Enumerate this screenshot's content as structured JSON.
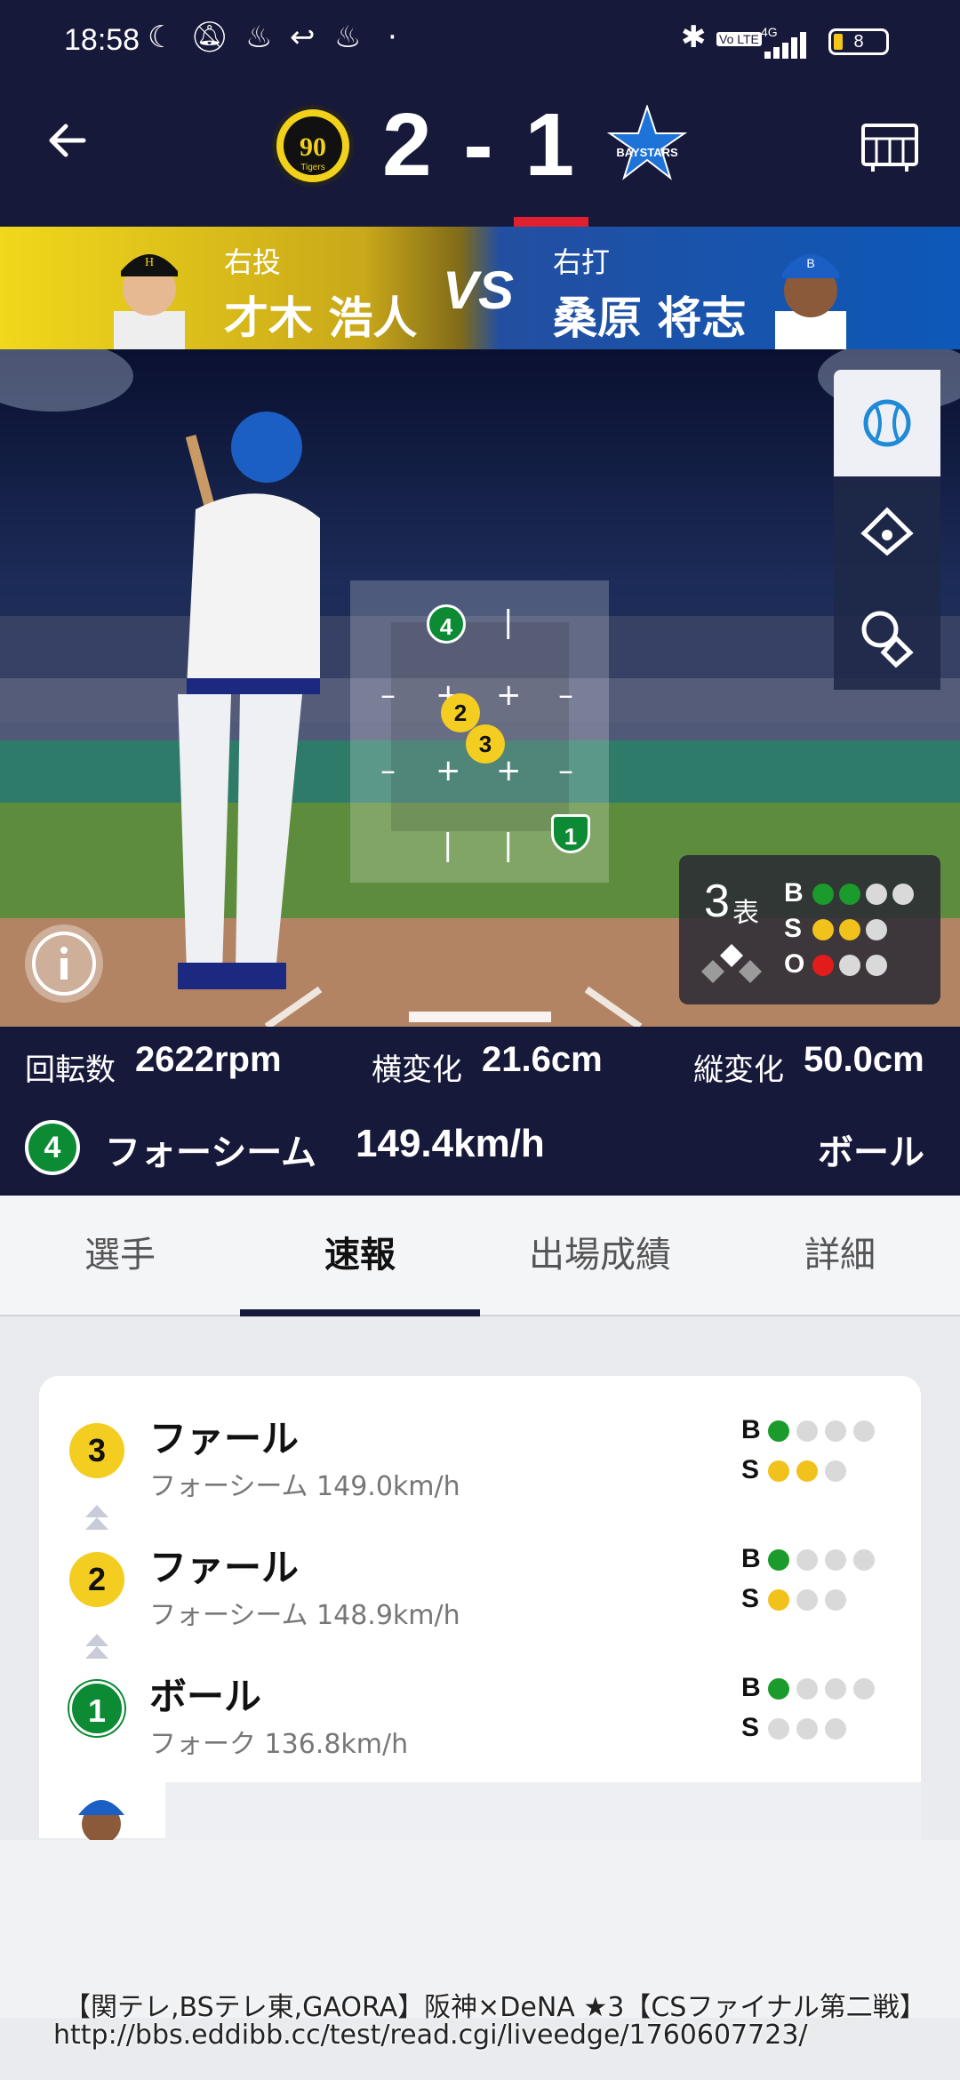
{
  "status_bar": {
    "time": "18:58",
    "battery": "8",
    "network": "4G",
    "volte": "Vo LTE"
  },
  "header": {
    "score": "2 - 1",
    "home_logo": "tigers-90th-logo",
    "away_logo": "baystars-logo",
    "logo_text_home": "Tigers",
    "logo_text_away": "BAYSTARS"
  },
  "matchup": {
    "pitcher_hand": "右投",
    "pitcher_name": "才木 浩人",
    "vs": "VS",
    "batter_hand": "右打",
    "batter_name": "桑原 将志"
  },
  "zone": {
    "pitches": [
      {
        "num": "4",
        "color": "green"
      },
      {
        "num": "2",
        "color": "yellow"
      },
      {
        "num": "3",
        "color": "yellow"
      },
      {
        "num": "1",
        "color": "green"
      }
    ]
  },
  "count": {
    "inning": "3",
    "half": "表",
    "b_label": "B",
    "s_label": "S",
    "o_label": "O",
    "balls": 2,
    "strikes": 2,
    "outs": 1
  },
  "stats": {
    "spin_label": "回転数",
    "spin_value": "2622rpm",
    "hbreak_label": "横変化",
    "hbreak_value": "21.6cm",
    "vbreak_label": "縦変化",
    "vbreak_value": "50.0cm"
  },
  "current_pitch": {
    "num": "4",
    "type": "フォーシーム",
    "speed": "149.4km/h",
    "result": "ボール"
  },
  "tabs": [
    "選手",
    "速報",
    "出場成績",
    "詳細"
  ],
  "feed": [
    {
      "num": "3",
      "title": "ファール",
      "detail": "フォーシーム 149.0km/h",
      "balls": 1,
      "strikes": 2
    },
    {
      "num": "2",
      "title": "ファール",
      "detail": "フォーシーム 148.9km/h",
      "balls": 1,
      "strikes": 1
    },
    {
      "num": "1",
      "title": "ボール",
      "detail": "フォーク 136.8km/h",
      "balls": 1,
      "strikes": 0
    }
  ],
  "feed_labels": {
    "b": "B",
    "s": "S"
  },
  "overlay": {
    "line1": "【関テレ,BSテレ東,GAORA】阪神×DeNA ★3【CSファイナル第二戦】",
    "line2": "http://bbs.eddibb.cc/test/read.cgi/liveedge/1760607723/"
  },
  "colors": {
    "navy": "#17193a",
    "accent_red": "#e02030",
    "ball_green": "#1a9b2b",
    "strike_yellow": "#f1c21b",
    "out_red": "#e21b1b"
  }
}
